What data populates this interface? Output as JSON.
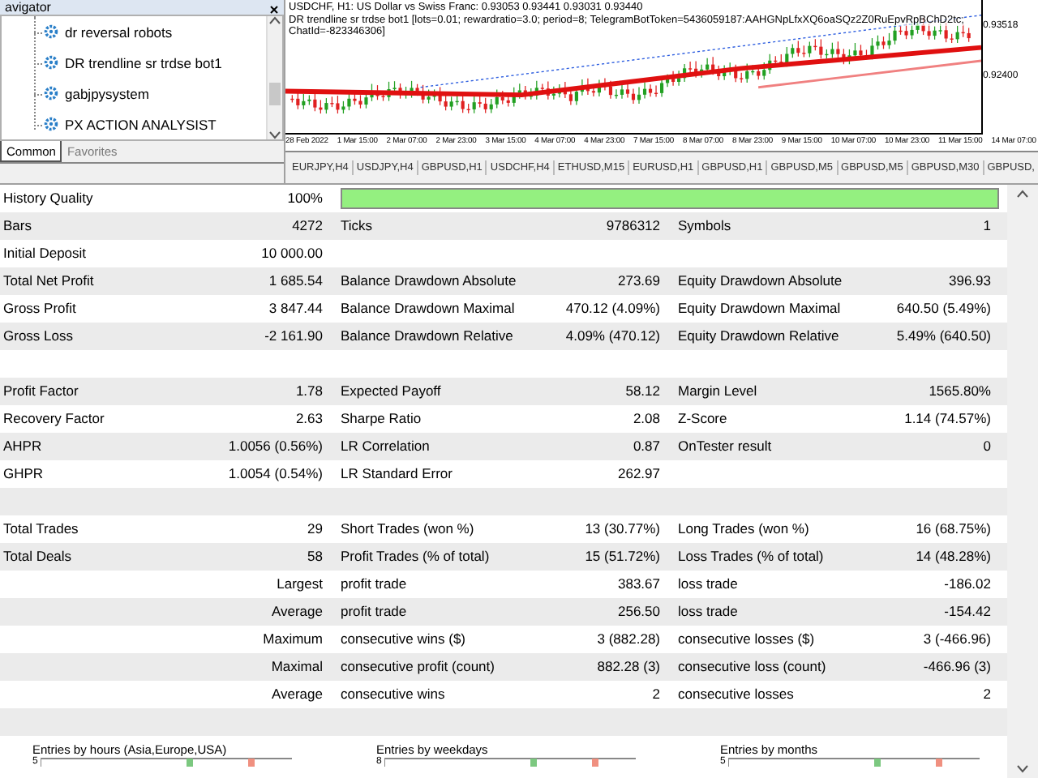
{
  "navigator": {
    "title": "avigator",
    "items": [
      {
        "label": "dr reversal robots"
      },
      {
        "label": "DR trendline sr trdse bot1"
      },
      {
        "label": "gabjpysystem"
      },
      {
        "label": "PX ACTION ANALYSIST"
      }
    ],
    "tabs": [
      {
        "label": "Common",
        "selected": true
      },
      {
        "label": "Favorites",
        "selected": false
      }
    ]
  },
  "chart": {
    "title": "USDCHF, H1: US Dollar vs Swiss Franc: 0.93053 0.93441 0.93031 0.93440",
    "indicator": "DR trendline sr trdse bot1 [lots=0.01; rewardratio=3.0; period=8; TelegramBotToken=5436059187:AAHGNpLfxXQ6oaSQz2Z0RuEpvRpBChD2tc; ChatId=-823346306]",
    "price_labels": [
      "0.93518",
      "0.92400"
    ],
    "time_labels": [
      "28 Feb 2022",
      "1 Mar 15:00",
      "2 Mar 07:00",
      "2 Mar 23:00",
      "3 Mar 15:00",
      "4 Mar 07:00",
      "4 Mar 23:00",
      "7 Mar 15:00",
      "8 Mar 07:00",
      "8 Mar 23:00",
      "9 Mar 15:00",
      "10 Mar 07:00",
      "10 Mar 23:00",
      "11 Mar 15:00",
      "14 Mar 07:00"
    ]
  },
  "chart_tabs": [
    "EURJPY,H4",
    "USDJPY,H4",
    "GBPUSD,H1",
    "USDCHF,H4",
    "ETHUSD,M15",
    "EURUSD,H1",
    "GBPUSD,H1",
    "GBPUSD,M5",
    "GBPUSD,M5",
    "GBPUSD,M30",
    "GBPUSD,"
  ],
  "report": {
    "history_quality": {
      "label": "History Quality",
      "value": "100%",
      "level": 1
    },
    "rows": [
      {
        "kind": "metrics",
        "cells": [
          {
            "label": "Bars",
            "value": "4272"
          },
          {
            "label": "Ticks",
            "value": "9786312"
          },
          {
            "label": "Symbols",
            "value": "1"
          }
        ]
      },
      {
        "kind": "metrics",
        "cells": [
          {
            "label": "Initial Deposit",
            "value": "10 000.00"
          }
        ]
      },
      {
        "kind": "metrics",
        "cells": [
          {
            "label": "Total Net Profit",
            "value": "1 685.54"
          },
          {
            "label": "Balance Drawdown Absolute",
            "value": "273.69"
          },
          {
            "label": "Equity Drawdown Absolute",
            "value": "396.93"
          }
        ]
      },
      {
        "kind": "metrics",
        "cells": [
          {
            "label": "Gross Profit",
            "value": "3 847.44"
          },
          {
            "label": "Balance Drawdown Maximal",
            "value": "470.12 (4.09%)"
          },
          {
            "label": "Equity Drawdown Maximal",
            "value": "640.50 (5.49%)"
          }
        ]
      },
      {
        "kind": "metrics",
        "cells": [
          {
            "label": "Gross Loss",
            "value": "-2 161.90"
          },
          {
            "label": "Balance Drawdown Relative",
            "value": "4.09% (470.12)"
          },
          {
            "label": "Equity Drawdown Relative",
            "value": "5.49% (640.50)"
          }
        ]
      },
      {
        "kind": "blank"
      },
      {
        "kind": "metrics",
        "cells": [
          {
            "label": "Profit Factor",
            "value": "1.78"
          },
          {
            "label": "Expected Payoff",
            "value": "58.12"
          },
          {
            "label": "Margin Level",
            "value": "1565.80%"
          }
        ]
      },
      {
        "kind": "metrics",
        "cells": [
          {
            "label": "Recovery Factor",
            "value": "2.63"
          },
          {
            "label": "Sharpe Ratio",
            "value": "2.08"
          },
          {
            "label": "Z-Score",
            "value": "1.14 (74.57%)"
          }
        ]
      },
      {
        "kind": "metrics",
        "cells": [
          {
            "label": "AHPR",
            "value": "1.0056 (0.56%)"
          },
          {
            "label": "LR Correlation",
            "value": "0.87"
          },
          {
            "label": "OnTester result",
            "value": "0"
          }
        ]
      },
      {
        "kind": "metrics",
        "cells": [
          {
            "label": "GHPR",
            "value": "1.0054 (0.54%)"
          },
          {
            "label": "LR Standard Error",
            "value": "262.97"
          }
        ]
      },
      {
        "kind": "blank"
      },
      {
        "kind": "metrics",
        "cells": [
          {
            "label": "Total Trades",
            "value": "29"
          },
          {
            "label": "Short Trades (won %)",
            "value": "13 (30.77%)"
          },
          {
            "label": "Long Trades (won %)",
            "value": "16 (68.75%)"
          }
        ]
      },
      {
        "kind": "metrics",
        "cells": [
          {
            "label": "Total Deals",
            "value": "58"
          },
          {
            "label": "Profit Trades (% of total)",
            "value": "15 (51.72%)"
          },
          {
            "label": "Loss Trades (% of total)",
            "value": "14 (48.28%)"
          }
        ]
      },
      {
        "kind": "sub",
        "head": "Largest",
        "cells": [
          {
            "label": "profit trade",
            "value": "383.67"
          },
          {
            "label": "loss trade",
            "value": "-186.02"
          }
        ]
      },
      {
        "kind": "sub",
        "head": "Average",
        "cells": [
          {
            "label": "profit trade",
            "value": "256.50"
          },
          {
            "label": "loss trade",
            "value": "-154.42"
          }
        ]
      },
      {
        "kind": "sub",
        "head": "Maximum",
        "cells": [
          {
            "label": "consecutive wins ($)",
            "value": "3 (882.28)"
          },
          {
            "label": "consecutive losses ($)",
            "value": "3 (-466.96)"
          }
        ]
      },
      {
        "kind": "sub",
        "head": "Maximal",
        "cells": [
          {
            "label": "consecutive profit (count)",
            "value": "882.28 (3)"
          },
          {
            "label": "consecutive loss (count)",
            "value": "-466.96 (3)"
          }
        ]
      },
      {
        "kind": "sub",
        "head": "Average",
        "cells": [
          {
            "label": "consecutive wins",
            "value": "2"
          },
          {
            "label": "consecutive losses",
            "value": "2"
          }
        ]
      },
      {
        "kind": "blank"
      }
    ],
    "mini_charts": [
      {
        "title": "Entries by hours (Asia,Europe,USA)",
        "tick": "5"
      },
      {
        "title": "Entries by weekdays",
        "tick": "8"
      },
      {
        "title": "Entries by months",
        "tick": "5"
      }
    ]
  }
}
